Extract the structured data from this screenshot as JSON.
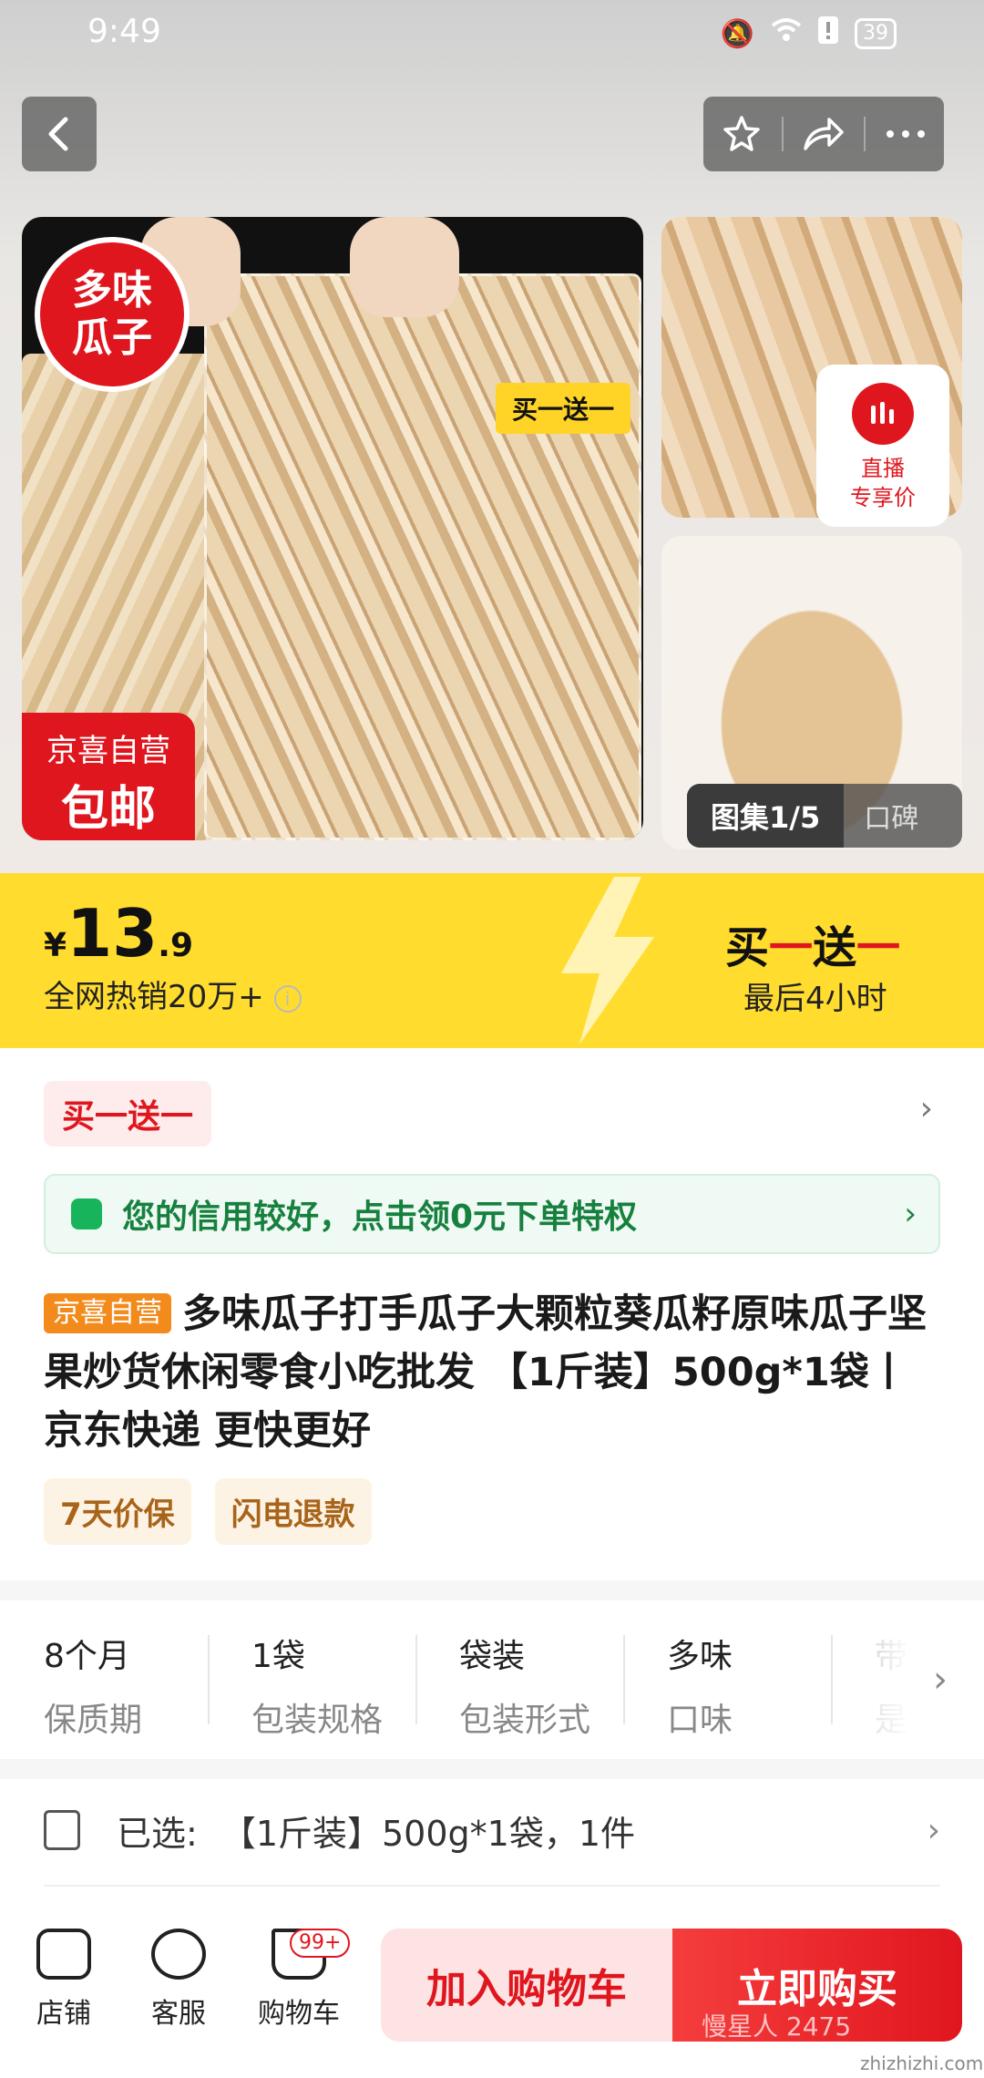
{
  "status_bar": {
    "time": "9:49",
    "battery": "39"
  },
  "gallery": {
    "badge_flavor": "多味\n瓜子",
    "buy_tag": "买一送一",
    "jx_line1": "京喜自营",
    "jx_line2": "包邮",
    "live_label": "直播\n专享价",
    "tab_active": "图集1/5",
    "tab_other": "口碑"
  },
  "price": {
    "currency": "¥",
    "integer": "13",
    "decimal": ".9",
    "sold": "全网热销20万+"
  },
  "promo": {
    "title_a": "买",
    "title_b": "一",
    "title_c": "送",
    "title_d": "一",
    "time_left": "最后4小时"
  },
  "offer_tag": "买一送一",
  "credit_text": "您的信用较好，点击领0元下单特权",
  "product": {
    "store_tag": "京喜自营",
    "title": "多味瓜子打手瓜子大颗粒葵瓜籽原味瓜子坚果炒货休闲零食小吃批发 【1斤装】500g*1袋丨京东快递 更快更好"
  },
  "guarantees": [
    "7天价保",
    "闪电退款"
  ],
  "specs": [
    {
      "value": "8个月",
      "key": "保质期"
    },
    {
      "value": "1袋",
      "key": "包装规格"
    },
    {
      "value": "袋装",
      "key": "包装形式"
    },
    {
      "value": "多味",
      "key": "口味"
    },
    {
      "value": "带",
      "key": "是"
    }
  ],
  "selected": {
    "label": "已选:",
    "value": "【1斤装】500g*1袋，1件"
  },
  "bottom_bar": {
    "store": "店铺",
    "service": "客服",
    "cart": "购物车",
    "cart_badge": "99+",
    "add_to_cart": "加入购物车",
    "buy_now": "立即购买"
  },
  "watermark": "慢星人 2475",
  "watermark_site": "zhizhizhi.com",
  "colors": {
    "accent_red": "#e0161e",
    "promo_yellow": "#ffdc2e",
    "credit_green": "#17803f"
  }
}
